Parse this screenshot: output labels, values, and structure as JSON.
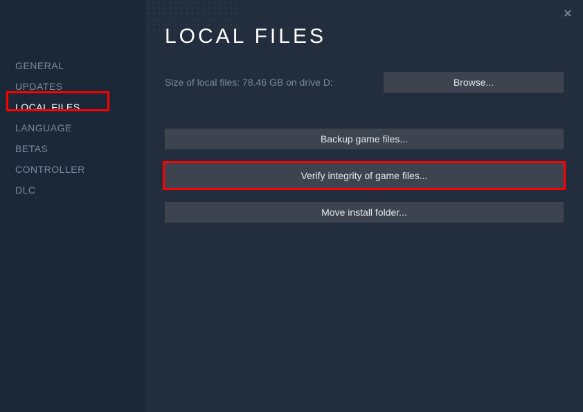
{
  "sidebar": {
    "items": [
      {
        "label": "GENERAL"
      },
      {
        "label": "UPDATES"
      },
      {
        "label": "LOCAL FILES"
      },
      {
        "label": "LANGUAGE"
      },
      {
        "label": "BETAS"
      },
      {
        "label": "CONTROLLER"
      },
      {
        "label": "DLC"
      }
    ]
  },
  "content": {
    "title": "LOCAL FILES",
    "size_text": "Size of local files: 78.46 GB on drive D:",
    "browse_label": "Browse...",
    "backup_label": "Backup game files...",
    "verify_label": "Verify integrity of game files...",
    "move_label": "Move install folder..."
  }
}
